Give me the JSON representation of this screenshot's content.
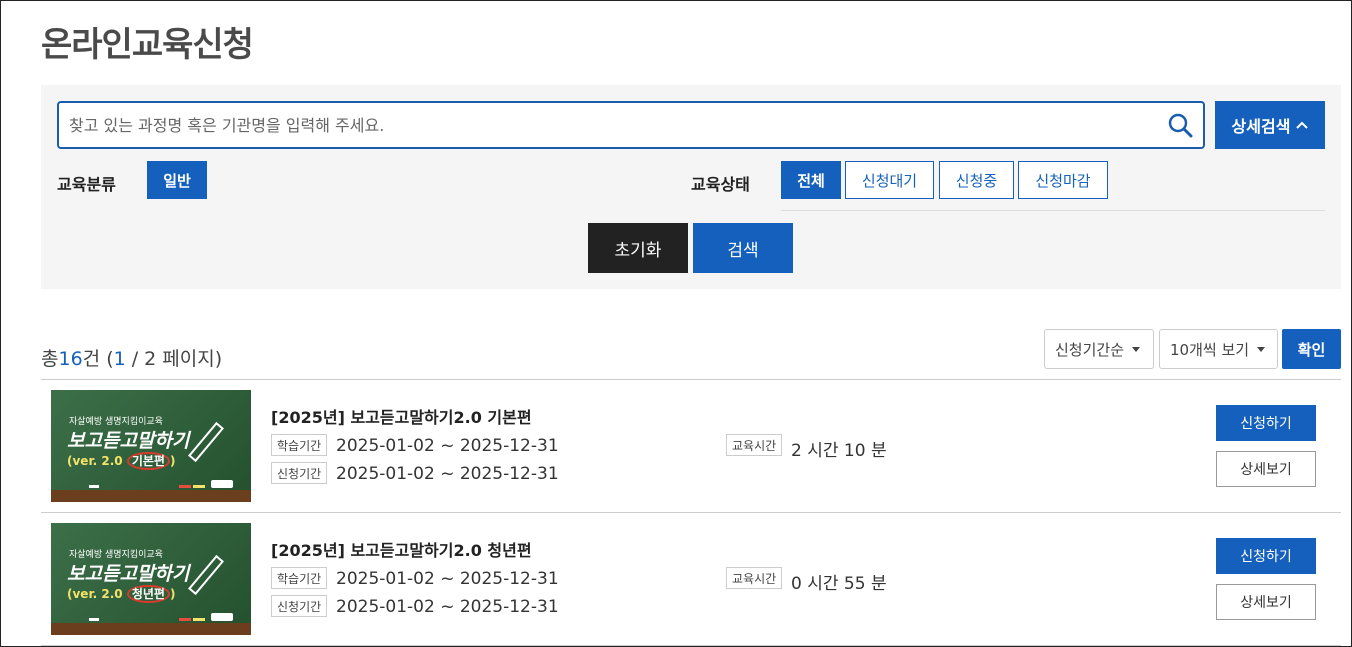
{
  "page": {
    "title": "온라인교육신청"
  },
  "search": {
    "placeholder": "찾고 있는 과정명 혹은 기관명을 입력해 주세요.",
    "advanced_label": "상세검색"
  },
  "filters": {
    "category_label": "교육분류",
    "category_options": [
      "일반"
    ],
    "status_label": "교육상태",
    "status_options": [
      "전체",
      "신청대기",
      "신청중",
      "신청마감"
    ],
    "reset_label": "초기화",
    "search_label": "검색"
  },
  "results": {
    "total_prefix": "총",
    "total_count": "16",
    "total_suffix": "건 (",
    "page_current": "1",
    "page_rest": " / 2 페이지)",
    "sort_selected": "신청기간순",
    "page_size_selected": "10개씩 보기",
    "confirm_label": "확인"
  },
  "courses": [
    {
      "title": "[2025년] 보고듣고말하기2.0 기본편",
      "study_label": "학습기간",
      "study_period": "2025-01-02 ~ 2025-12-31",
      "apply_label": "신청기간",
      "apply_period": "2025-01-02 ~ 2025-12-31",
      "time_label": "교육시간",
      "time_value": "2 시간 10 분",
      "apply_button": "신청하기",
      "detail_button": "상세보기",
      "thumb": {
        "line1": "자살예방 생명지킴이교육",
        "line2": "보고듣고말하기",
        "line3": "(ver. 2.0 ",
        "highlight": "기본편",
        "line3_end": ")"
      }
    },
    {
      "title": "[2025년] 보고듣고말하기2.0 청년편",
      "study_label": "학습기간",
      "study_period": "2025-01-02 ~ 2025-12-31",
      "apply_label": "신청기간",
      "apply_period": "2025-01-02 ~ 2025-12-31",
      "time_label": "교육시간",
      "time_value": "0 시간 55 분",
      "apply_button": "신청하기",
      "detail_button": "상세보기",
      "thumb": {
        "line1": "자살예방 생명지킴이교육",
        "line2": "보고듣고말하기",
        "line3": "(ver. 2.0 ",
        "highlight": "청년편",
        "line3_end": ")"
      }
    }
  ],
  "colors": {
    "primary": "#1560bd",
    "dark": "#222222",
    "panel_bg": "#f5f5f5"
  }
}
